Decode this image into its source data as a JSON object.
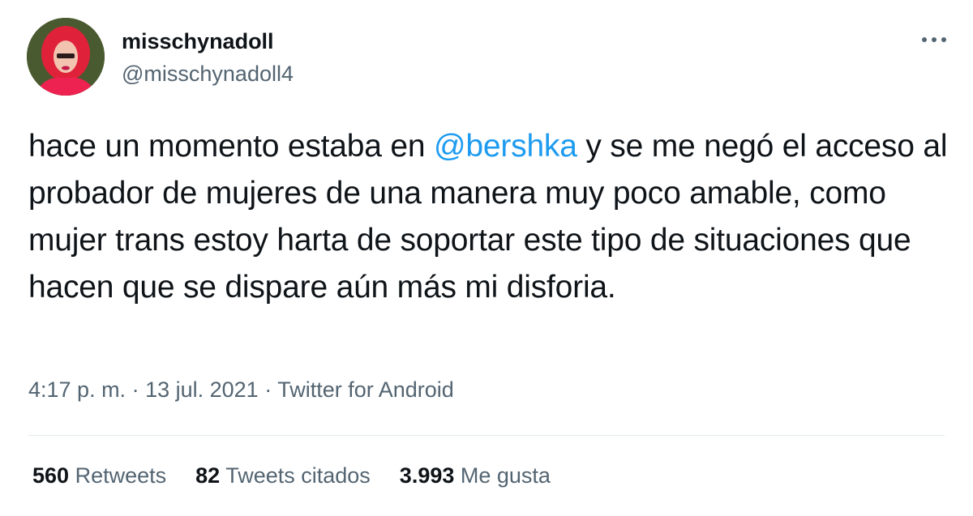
{
  "tweet": {
    "author": {
      "display_name": "misschynadoll",
      "handle": "@misschynadoll4",
      "avatar_icon": "avatar-photo"
    },
    "more_icon": "more-horizontal-icon",
    "text": {
      "before_mention": "hace un momento estaba en ",
      "mention": "@bershka",
      "after_mention": " y se me negó el acceso al probador de mujeres de una manera muy poco amable, como mujer trans estoy harta de soportar este tipo de situaciones que hacen que se dispare aún más mi disforia."
    },
    "meta": {
      "time": "4:17 p. m.",
      "separator": " · ",
      "date": "13 jul. 2021",
      "source": "Twitter for Android"
    },
    "stats": {
      "retweets_count": "560",
      "retweets_label": "Retweets",
      "quotes_count": "82",
      "quotes_label": "Tweets citados",
      "likes_count": "3.993",
      "likes_label": "Me gusta"
    },
    "colors": {
      "link": "#1d9bf0",
      "secondary_text": "#536471",
      "primary_text": "#0f1419"
    }
  }
}
